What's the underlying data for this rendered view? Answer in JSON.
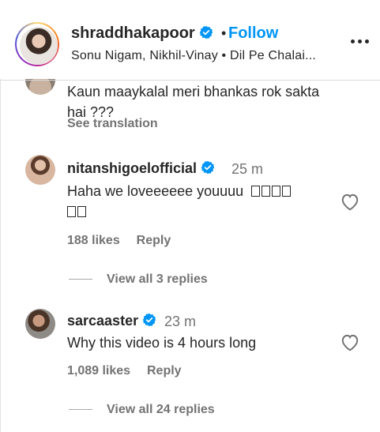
{
  "post_header": {
    "username": "shraddhakapoor",
    "separator": "•",
    "follow_label": "Follow",
    "audio_subtitle": "Sonu Nigam, Nikhil-Vinay • Dil Pe Chalai..."
  },
  "previous_comment": {
    "text": "Kaun maaykalal meri bhankas rok sakta hai ???",
    "see_translation_label": "See translation"
  },
  "comments": [
    {
      "username": "nitanshigoelofficial",
      "verified": true,
      "time_ago": "25 m",
      "text": "Haha we loveeeeee youuuu",
      "emoji_placeholder_count": 6,
      "likes_label": "188 likes",
      "reply_label": "Reply",
      "view_replies_label": "View all 3 replies"
    },
    {
      "username": "sarcaaster",
      "verified": true,
      "time_ago": "23 m",
      "text": "Why this video is 4 hours long",
      "likes_label": "1,089 likes",
      "reply_label": "Reply",
      "view_replies_label": "View all 24 replies"
    }
  ],
  "colors": {
    "link_blue": "#0095f6",
    "verified_blue": "#0095f6",
    "text_primary": "#262626",
    "text_secondary": "#737373"
  },
  "icons": {
    "verified": "verified-badge-icon",
    "more": "more-options-icon",
    "like": "heart-outline-icon"
  }
}
